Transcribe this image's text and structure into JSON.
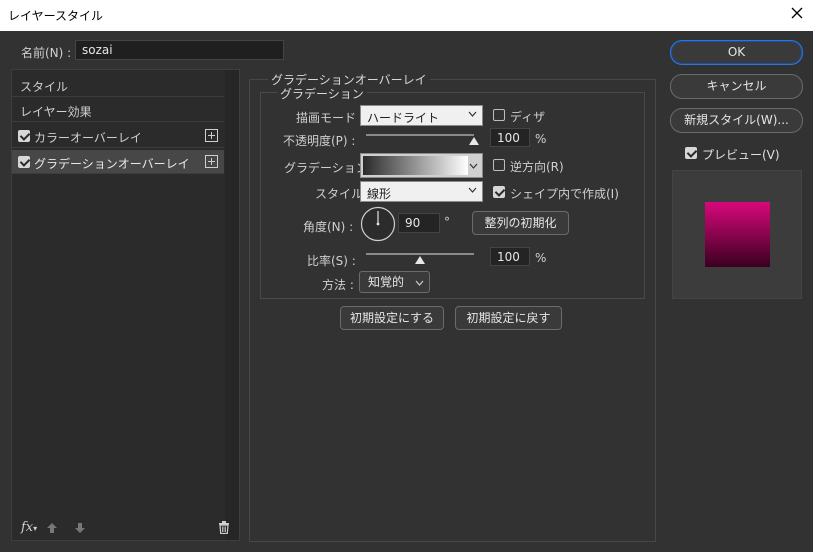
{
  "window": {
    "title": "レイヤースタイル"
  },
  "name_field": {
    "label": "名前(N) :",
    "value": "sozai"
  },
  "left_panel": {
    "items": [
      {
        "label": "スタイル",
        "checkbox": false
      },
      {
        "label": "レイヤー効果",
        "checkbox": false
      },
      {
        "label": "カラーオーバーレイ",
        "checkbox": true,
        "checked": true,
        "plus": true
      },
      {
        "label": "グラデーションオーバーレイ",
        "checkbox": true,
        "checked": true,
        "plus": true,
        "selected": true
      }
    ],
    "footer_icons": [
      "fx-icon",
      "arrow-up-icon",
      "arrow-down-icon",
      "trash-icon"
    ]
  },
  "gradient_overlay": {
    "group_title": "グラデーションオーバーレイ",
    "subgroup_title": "グラデーション",
    "blend_mode": {
      "label": "描画モード :",
      "value": "ハードライト"
    },
    "dither": {
      "label": "ディザ",
      "checked": false
    },
    "opacity": {
      "label": "不透明度(P) :",
      "value": "100",
      "unit": "%",
      "level": 1.0
    },
    "gradient": {
      "label": "グラデーション :"
    },
    "reverse": {
      "label": "逆方向(R)",
      "checked": false
    },
    "style": {
      "label": "スタイル :",
      "value": "線形"
    },
    "align_with_layer": {
      "label": "シェイプ内で作成(I)",
      "checked": true
    },
    "angle": {
      "label": "角度(N) :",
      "value": "90",
      "unit": "°"
    },
    "reset_alignment_button": "整列の初期化",
    "scale": {
      "label": "比率(S) :",
      "value": "100",
      "unit": "%",
      "level": 0.5
    },
    "method": {
      "label": "方法 :",
      "value": "知覚的"
    },
    "make_default_button": "初期設定にする",
    "reset_default_button": "初期設定に戻す"
  },
  "right_panel": {
    "ok_button": "OK",
    "cancel_button": "キャンセル",
    "new_style_button": "新規スタイル(W)...",
    "preview": {
      "label": "プレビュー(V)",
      "checked": true
    },
    "preview_gradient": {
      "top": "#d8087c",
      "bottom": "#3a0020"
    }
  },
  "colors": {
    "accent": "#2f76d6",
    "dialog_bg": "#323232"
  }
}
